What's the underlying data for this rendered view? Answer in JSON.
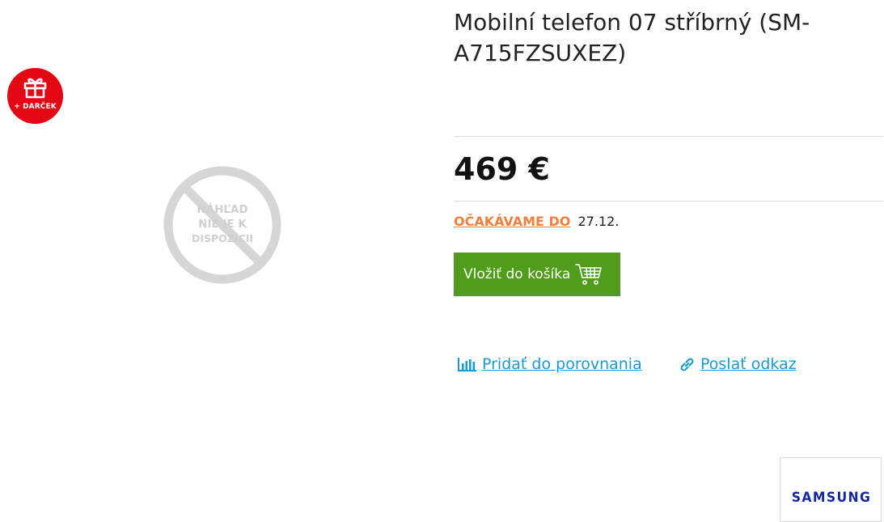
{
  "product": {
    "title": "Mobilní telefon 07 stříbrný (SM-A715FZSUXEZ)",
    "price": "469 €",
    "availability_status": "OČAKÁVAME DO",
    "availability_date": "27.12."
  },
  "badges": {
    "gift_label": "+ DARČEK",
    "gift_color": "#e30613"
  },
  "image_placeholder": {
    "line1": "NÁHĽAD",
    "line2": "NIE JE K",
    "line3": "DISPOZÍCII",
    "icon": "no-image-icon"
  },
  "actions": {
    "add_to_cart_label": "Vložiť do košíka",
    "add_to_cart_icon": "cart-icon",
    "compare_label": "Pridať do porovnania",
    "compare_icon": "bar-chart-icon",
    "send_link_label": "Poslať odkaz",
    "send_link_icon": "link-icon"
  },
  "brand": {
    "name": "SAMSUNG",
    "color": "#1428a0"
  },
  "colors": {
    "accent_green": "#4f9d1b",
    "status_orange": "#f0803c",
    "link_blue": "#1a9ad6"
  }
}
